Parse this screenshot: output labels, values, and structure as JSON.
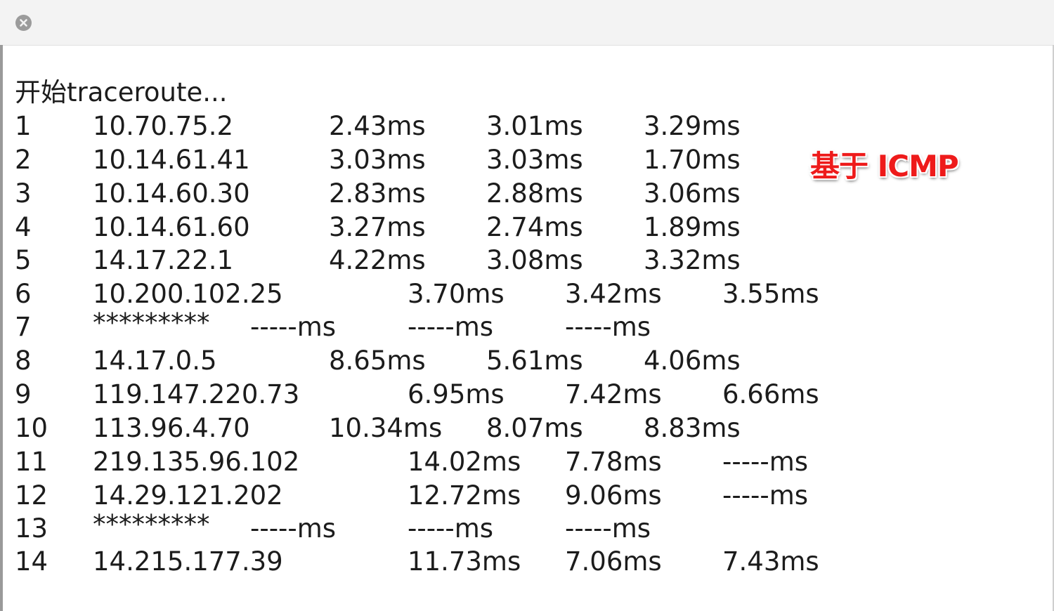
{
  "window": {
    "close_icon": "close-icon"
  },
  "header": "开始traceroute...",
  "annotation": "基于 ICMP",
  "hops": [
    {
      "hop": "1",
      "ip": "10.70.75.2",
      "t1": "2.43ms",
      "t2": "3.01ms",
      "t3": "3.29ms"
    },
    {
      "hop": "2",
      "ip": "10.14.61.41",
      "t1": "3.03ms",
      "t2": "3.03ms",
      "t3": "1.70ms"
    },
    {
      "hop": "3",
      "ip": "10.14.60.30",
      "t1": "2.83ms",
      "t2": "2.88ms",
      "t3": "3.06ms"
    },
    {
      "hop": "4",
      "ip": "10.14.61.60",
      "t1": "3.27ms",
      "t2": "2.74ms",
      "t3": "1.89ms"
    },
    {
      "hop": "5",
      "ip": "14.17.22.1",
      "t1": "4.22ms",
      "t2": "3.08ms",
      "t3": "3.32ms"
    },
    {
      "hop": "6",
      "ip": "10.200.102.25",
      "t1": "3.70ms",
      "t2": "3.42ms",
      "t3": "3.55ms"
    },
    {
      "hop": "7",
      "ip": "*********",
      "t1": "-----ms",
      "t2": "-----ms",
      "t3": "-----ms"
    },
    {
      "hop": "8",
      "ip": "14.17.0.5",
      "t1": "8.65ms",
      "t2": "5.61ms",
      "t3": "4.06ms"
    },
    {
      "hop": "9",
      "ip": "119.147.220.73",
      "t1": "6.95ms",
      "t2": "7.42ms",
      "t3": "6.66ms"
    },
    {
      "hop": "10",
      "ip": "113.96.4.70",
      "t1": "10.34ms",
      "t2": "8.07ms",
      "t3": "8.83ms"
    },
    {
      "hop": "11",
      "ip": "219.135.96.102",
      "t1": "14.02ms",
      "t2": "7.78ms",
      "t3": "-----ms"
    },
    {
      "hop": "12",
      "ip": "14.29.121.202",
      "t1": "12.72ms",
      "t2": "9.06ms",
      "t3": "-----ms"
    },
    {
      "hop": "13",
      "ip": "*********",
      "t1": "-----ms",
      "t2": "-----ms",
      "t3": "-----ms"
    },
    {
      "hop": "14",
      "ip": "14.215.177.39",
      "t1": "11.73ms",
      "t2": "7.06ms",
      "t3": "7.43ms"
    }
  ]
}
